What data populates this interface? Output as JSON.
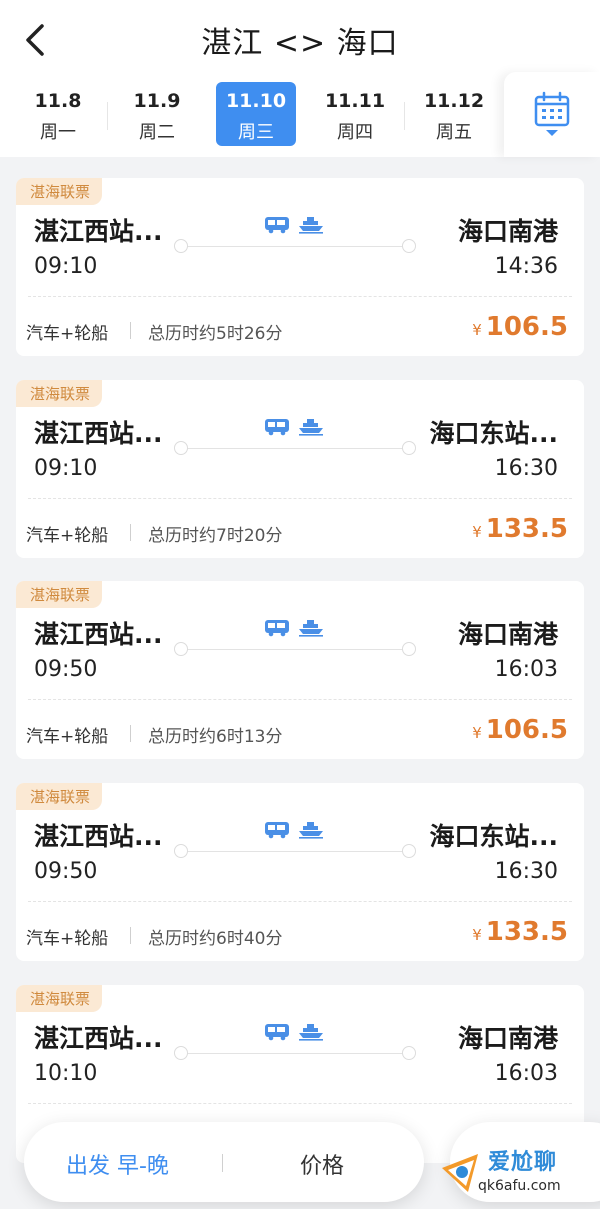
{
  "header": {
    "title": "湛江 <> 海口"
  },
  "dates": [
    {
      "date": "11.8",
      "weekday": "周一",
      "active": false
    },
    {
      "date": "11.9",
      "weekday": "周二",
      "active": false
    },
    {
      "date": "11.10",
      "weekday": "周三",
      "active": true
    },
    {
      "date": "11.11",
      "weekday": "周四",
      "active": false
    },
    {
      "date": "11.12",
      "weekday": "周五",
      "active": false
    }
  ],
  "results": [
    {
      "tag": "湛海联票",
      "from": "湛江西站...",
      "to": "海口南港",
      "depart": "09:10",
      "arrive": "14:36",
      "type": "汽车+轮船",
      "duration": "总历时约5时26分",
      "currency": "¥",
      "price": "106.5"
    },
    {
      "tag": "湛海联票",
      "from": "湛江西站...",
      "to": "海口东站...",
      "depart": "09:10",
      "arrive": "16:30",
      "type": "汽车+轮船",
      "duration": "总历时约7时20分",
      "currency": "¥",
      "price": "133.5"
    },
    {
      "tag": "湛海联票",
      "from": "湛江西站...",
      "to": "海口南港",
      "depart": "09:50",
      "arrive": "16:03",
      "type": "汽车+轮船",
      "duration": "总历时约6时13分",
      "currency": "¥",
      "price": "106.5"
    },
    {
      "tag": "湛海联票",
      "from": "湛江西站...",
      "to": "海口东站...",
      "depart": "09:50",
      "arrive": "16:30",
      "type": "汽车+轮船",
      "duration": "总历时约6时40分",
      "currency": "¥",
      "price": "133.5"
    },
    {
      "tag": "湛海联票",
      "from": "湛江西站...",
      "to": "海口南港",
      "depart": "10:10",
      "arrive": "16:03"
    }
  ],
  "filter": {
    "time_label": "出发 早-晚",
    "price_label": "价格"
  },
  "watermark": {
    "text": "爱尬聊",
    "url": "qk6afu.com"
  },
  "colors": {
    "accent": "#3f8ef0",
    "price": "#e07a2e",
    "tag_bg": "#fbe9d4",
    "tag_text": "#d08a3e"
  }
}
